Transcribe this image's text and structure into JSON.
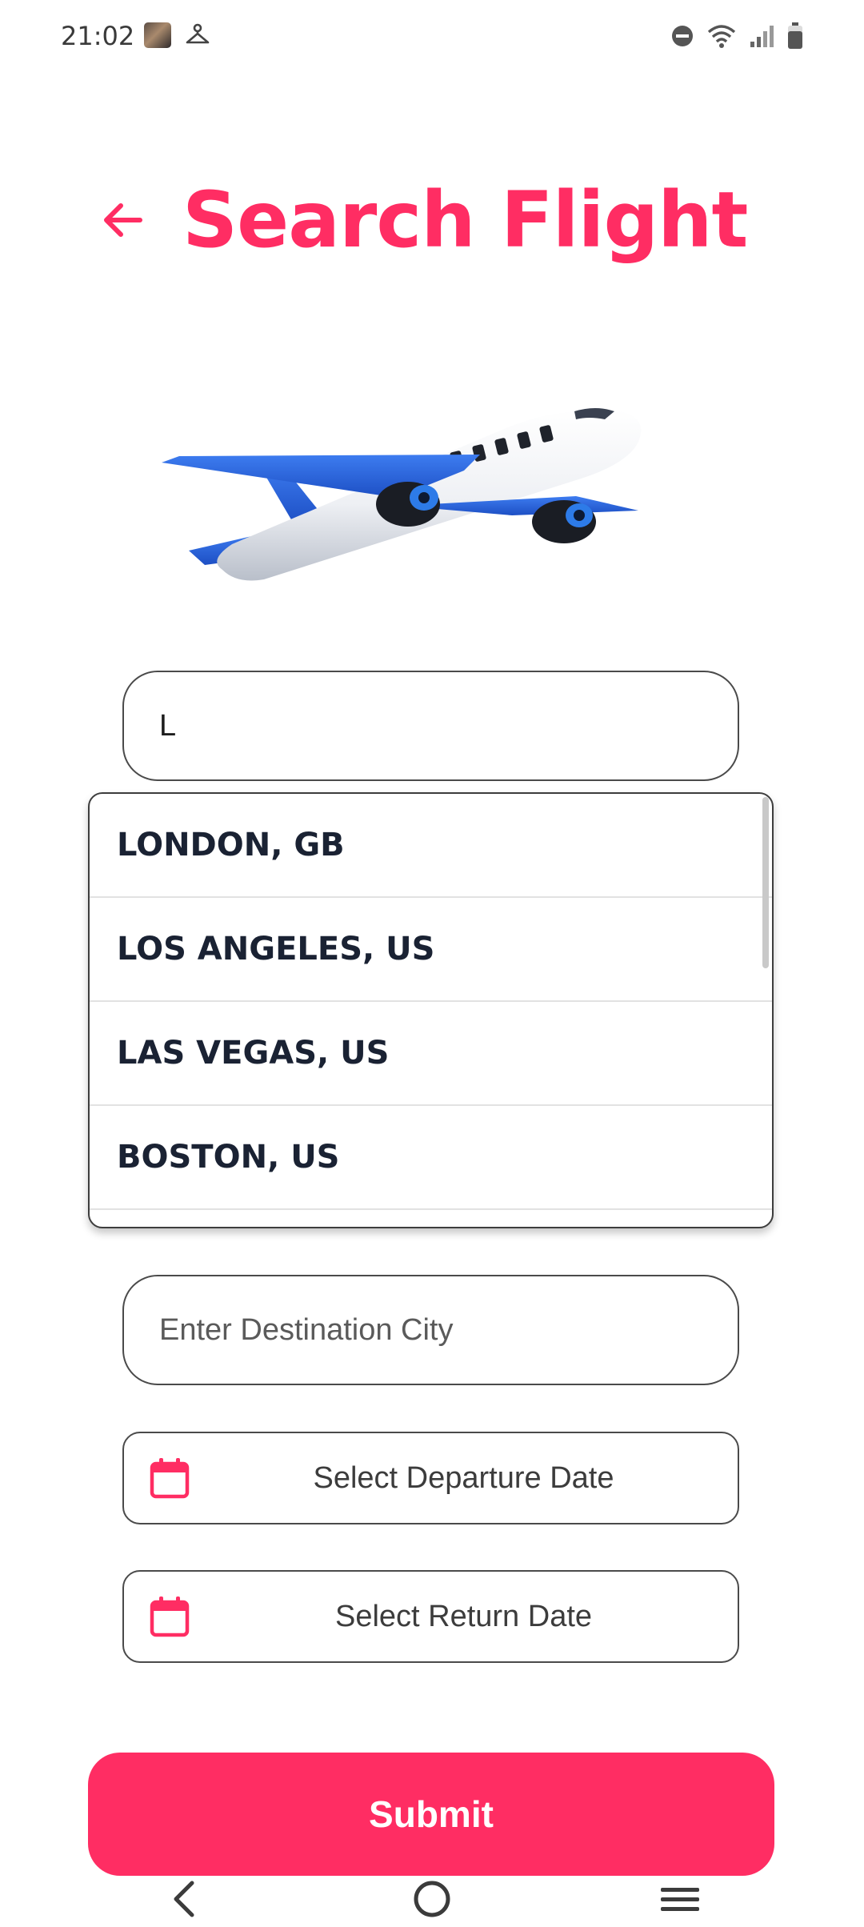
{
  "status_bar": {
    "time": "21:02"
  },
  "header": {
    "title": "Search Flight",
    "back_icon": "arrow-left-icon"
  },
  "illustration": {
    "icon": "airplane-icon"
  },
  "origin_field": {
    "value": "L"
  },
  "suggestions": [
    "LONDON, GB",
    "LOS ANGELES, US",
    "LAS VEGAS, US",
    "BOSTON, US"
  ],
  "destination_field": {
    "placeholder": "Enter Destination City"
  },
  "departure_date": {
    "label": "Select Departure Date",
    "icon": "calendar-icon"
  },
  "return_date": {
    "label": "Select Return Date",
    "icon": "calendar-icon"
  },
  "submit": {
    "label": "Submit"
  },
  "colors": {
    "accent": "#ff2d63",
    "suggestion_text": "#1a2233",
    "border": "#4a4a4a"
  }
}
